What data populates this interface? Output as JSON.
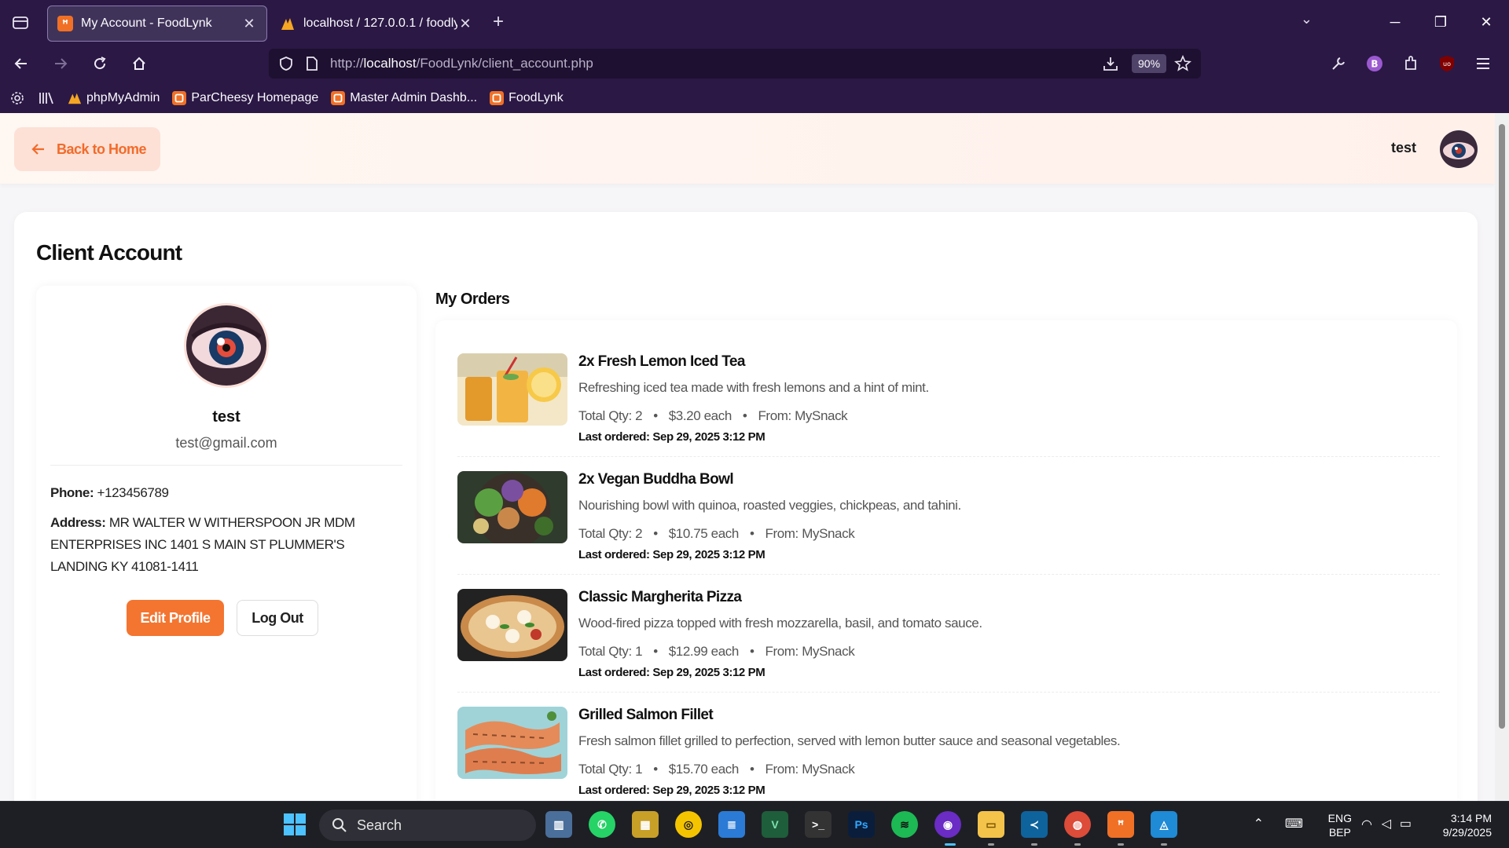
{
  "browser": {
    "tabs": [
      {
        "title": "My Account - FoodLynk",
        "active": true
      },
      {
        "title": "localhost / 127.0.0.1 / foodlynk /",
        "active": false
      }
    ],
    "url_prefix": "http://",
    "url_host": "localhost",
    "url_path": "/FoodLynk/client_account.php",
    "zoom": "90%",
    "bookmarks": [
      "phpMyAdmin",
      "ParCheesy Homepage",
      "Master Admin Dashb...",
      "FoodLynk"
    ]
  },
  "header": {
    "back_label": "Back to Home",
    "username": "test"
  },
  "account": {
    "title": "Client Account",
    "name": "test",
    "email": "test@gmail.com",
    "phone_label": "Phone:",
    "phone": "+123456789",
    "address_label": "Address:",
    "address": "MR WALTER W WITHERSPOON JR MDM ENTERPRISES INC 1401 S MAIN ST PLUMMER'S LANDING KY 41081-1411",
    "edit_label": "Edit Profile",
    "logout_label": "Log Out"
  },
  "orders": {
    "title": "My Orders",
    "items": [
      {
        "name": "2x Fresh Lemon Iced Tea",
        "desc": "Refreshing iced tea made with fresh lemons and a hint of mint.",
        "qty": "Total Qty: 2",
        "price": "$3.20 each",
        "from": "From: MySnack",
        "date": "Last ordered: Sep 29, 2025 3:12 PM"
      },
      {
        "name": "2x Vegan Buddha Bowl",
        "desc": "Nourishing bowl with quinoa, roasted veggies, chickpeas, and tahini.",
        "qty": "Total Qty: 2",
        "price": "$10.75 each",
        "from": "From: MySnack",
        "date": "Last ordered: Sep 29, 2025 3:12 PM"
      },
      {
        "name": "Classic Margherita Pizza",
        "desc": "Wood-fired pizza topped with fresh mozzarella, basil, and tomato sauce.",
        "qty": "Total Qty: 1",
        "price": "$12.99 each",
        "from": "From: MySnack",
        "date": "Last ordered: Sep 29, 2025 3:12 PM"
      },
      {
        "name": "Grilled Salmon Fillet",
        "desc": "Fresh salmon fillet grilled to perfection, served with lemon butter sauce and seasonal vegetables.",
        "qty": "Total Qty: 1",
        "price": "$15.70 each",
        "from": "From: MySnack",
        "date": "Last ordered: Sep 29, 2025 3:12 PM"
      }
    ]
  },
  "taskbar": {
    "search_label": "Search",
    "lang_line1": "ENG",
    "lang_line2": "BEP",
    "time": "3:14 PM",
    "date": "9/29/2025"
  },
  "colors": {
    "accent": "#f47530",
    "chrome": "#2b1845"
  }
}
